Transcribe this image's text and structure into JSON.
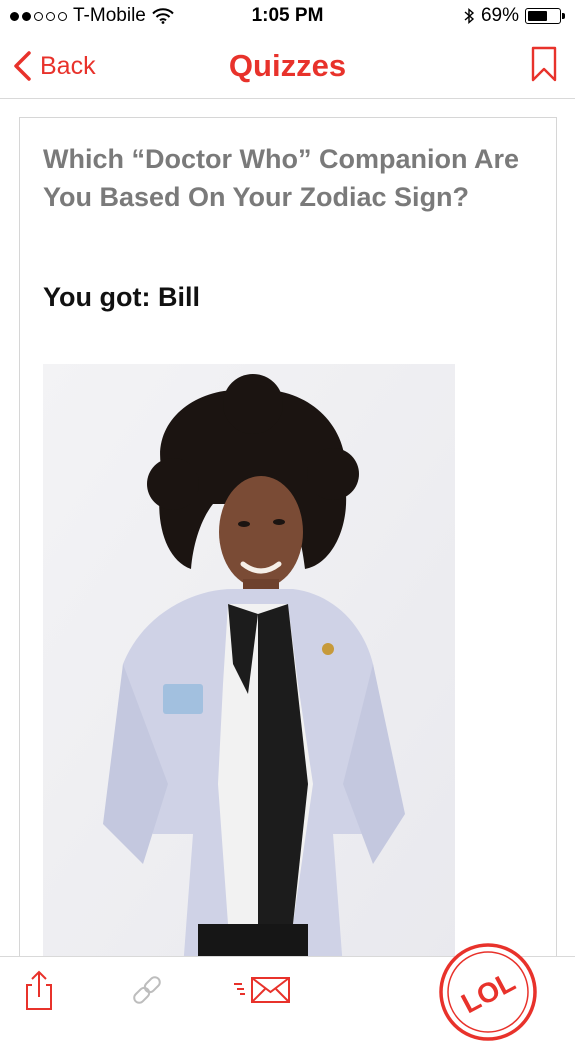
{
  "status_bar": {
    "carrier": "T-Mobile",
    "time": "1:05 PM",
    "battery_percent": "69%",
    "battery_level": 0.69,
    "signal_bars_filled": 2,
    "signal_bars_total": 5
  },
  "nav": {
    "back_label": "Back",
    "title": "Quizzes"
  },
  "quiz": {
    "title": "Which “Doctor Who” Companion Are You Based On Your Zodiac Sign?",
    "result": "You got: Bill"
  },
  "toolbar": {
    "lol_label": "LOL"
  },
  "colors": {
    "accent": "#e8322b",
    "title_gray": "#7a7a7a"
  },
  "icons": [
    "chevron-left-icon",
    "bookmark-icon",
    "share-icon",
    "link-icon",
    "email-icon",
    "lol-badge-icon",
    "wifi-icon",
    "bluetooth-icon",
    "battery-icon"
  ]
}
